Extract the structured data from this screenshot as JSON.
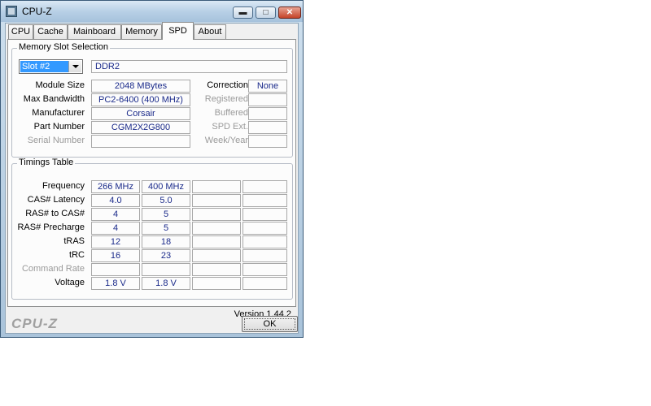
{
  "window": {
    "title": "CPU-Z"
  },
  "tabs": [
    {
      "label": "CPU"
    },
    {
      "label": "Cache"
    },
    {
      "label": "Mainboard"
    },
    {
      "label": "Memory"
    },
    {
      "label": "SPD",
      "active": true
    },
    {
      "label": "About"
    }
  ],
  "slot_selection": {
    "group_label": "Memory Slot Selection",
    "selected_slot": "Slot #2",
    "memory_type": "DDR2",
    "rows": [
      {
        "label": "Module Size",
        "value": "2048 MBytes",
        "dim": false
      },
      {
        "label": "Max Bandwidth",
        "value": "PC2-6400 (400 MHz)",
        "dim": false
      },
      {
        "label": "Manufacturer",
        "value": "Corsair",
        "dim": false
      },
      {
        "label": "Part Number",
        "value": "CGM2X2G800",
        "dim": false
      },
      {
        "label": "Serial Number",
        "value": "",
        "dim": true
      }
    ],
    "right_rows": [
      {
        "label": "Correction",
        "value": "None",
        "dim": false
      },
      {
        "label": "Registered",
        "value": "",
        "dim": true
      },
      {
        "label": "Buffered",
        "value": "",
        "dim": true
      },
      {
        "label": "SPD Ext.",
        "value": "",
        "dim": true
      },
      {
        "label": "Week/Year",
        "value": "",
        "dim": true
      }
    ]
  },
  "timings": {
    "group_label": "Timings Table",
    "rows": [
      {
        "label": "Frequency",
        "values": [
          "266 MHz",
          "400 MHz",
          "",
          ""
        ],
        "dim": false
      },
      {
        "label": "CAS# Latency",
        "values": [
          "4.0",
          "5.0",
          "",
          ""
        ],
        "dim": false
      },
      {
        "label": "RAS# to CAS#",
        "values": [
          "4",
          "5",
          "",
          ""
        ],
        "dim": false
      },
      {
        "label": "RAS# Precharge",
        "values": [
          "4",
          "5",
          "",
          ""
        ],
        "dim": false
      },
      {
        "label": "tRAS",
        "values": [
          "12",
          "18",
          "",
          ""
        ],
        "dim": false
      },
      {
        "label": "tRC",
        "values": [
          "16",
          "23",
          "",
          ""
        ],
        "dim": false
      },
      {
        "label": "Command Rate",
        "values": [
          "",
          "",
          "",
          ""
        ],
        "dim": true
      },
      {
        "label": "Voltage",
        "values": [
          "1.8 V",
          "1.8 V",
          "",
          ""
        ],
        "dim": false
      }
    ]
  },
  "version_text": "Version 1.44.2",
  "footer": {
    "brand": "CPU-Z",
    "ok_label": "OK"
  },
  "icons": {
    "app": "cpu-z-app-icon",
    "minimize": "minimize-icon",
    "maximize": "maximize-icon",
    "close": "close-icon",
    "dropdown": "chevron-down-icon"
  }
}
